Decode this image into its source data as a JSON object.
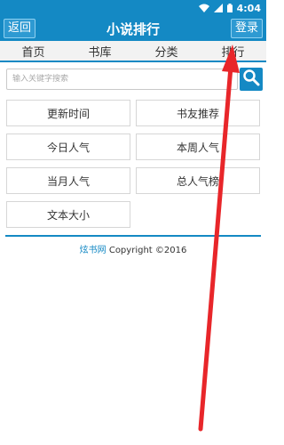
{
  "status_bar": {
    "time": "4:04"
  },
  "header": {
    "back_label": "返回",
    "title": "小说排行",
    "login_label": "登录"
  },
  "nav": {
    "items": [
      "首页",
      "书库",
      "分类",
      "排行"
    ]
  },
  "search": {
    "placeholder": "输入关键字搜索"
  },
  "menu": {
    "items": [
      "更新时间",
      "书友推荐",
      "今日人气",
      "本周人气",
      "当月人气",
      "总人气榜",
      "文本大小"
    ]
  },
  "footer": {
    "brand": "炫书网",
    "copyright": " Copyright ©2016"
  },
  "colors": {
    "primary": "#1489c4",
    "annotation_arrow": "#e8262a"
  }
}
